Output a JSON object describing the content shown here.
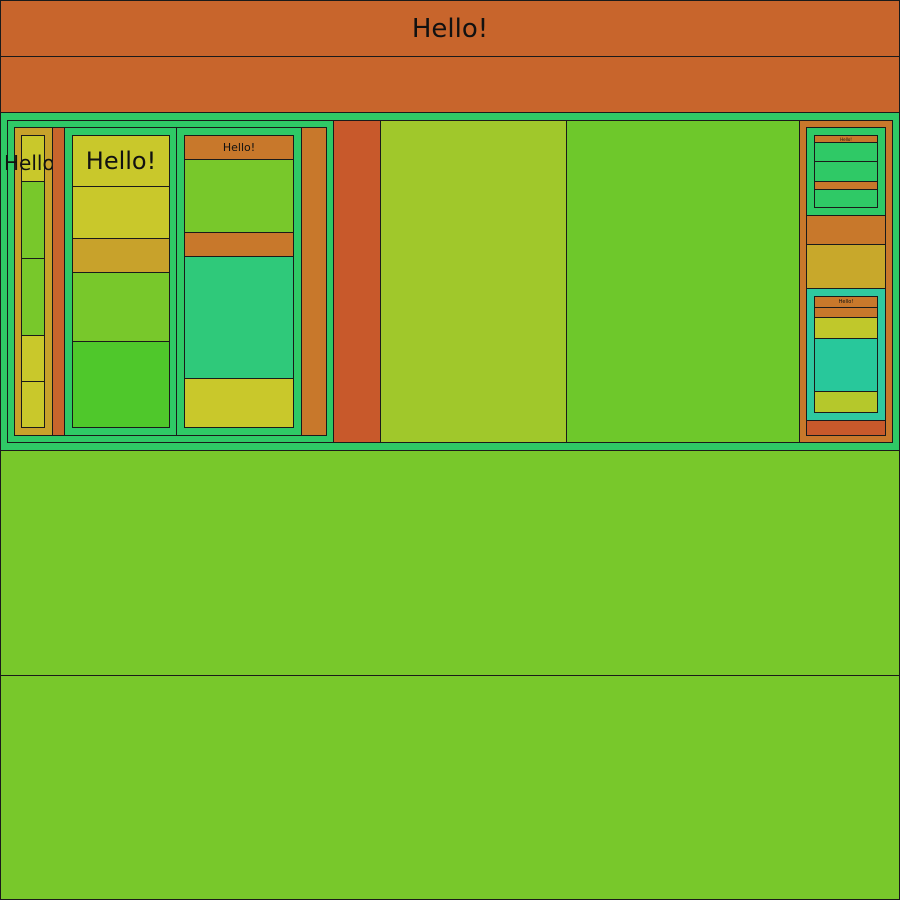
{
  "header": {
    "title": "Hello!"
  },
  "left_panel": {
    "label": "Hello"
  },
  "middle_panel": {
    "title": "Hello!"
  },
  "right_panel": {
    "heading": "Hello!"
  },
  "right_widgets": {
    "top_label": "Hello!",
    "lower_label": "Hello!"
  },
  "colors": {
    "orange": "#c8652c",
    "green": "#2fc966",
    "lime": "#78c82b",
    "yellow_green": "#a0c82b",
    "yellow": "#c9c82b",
    "teal": "#28c89b"
  }
}
